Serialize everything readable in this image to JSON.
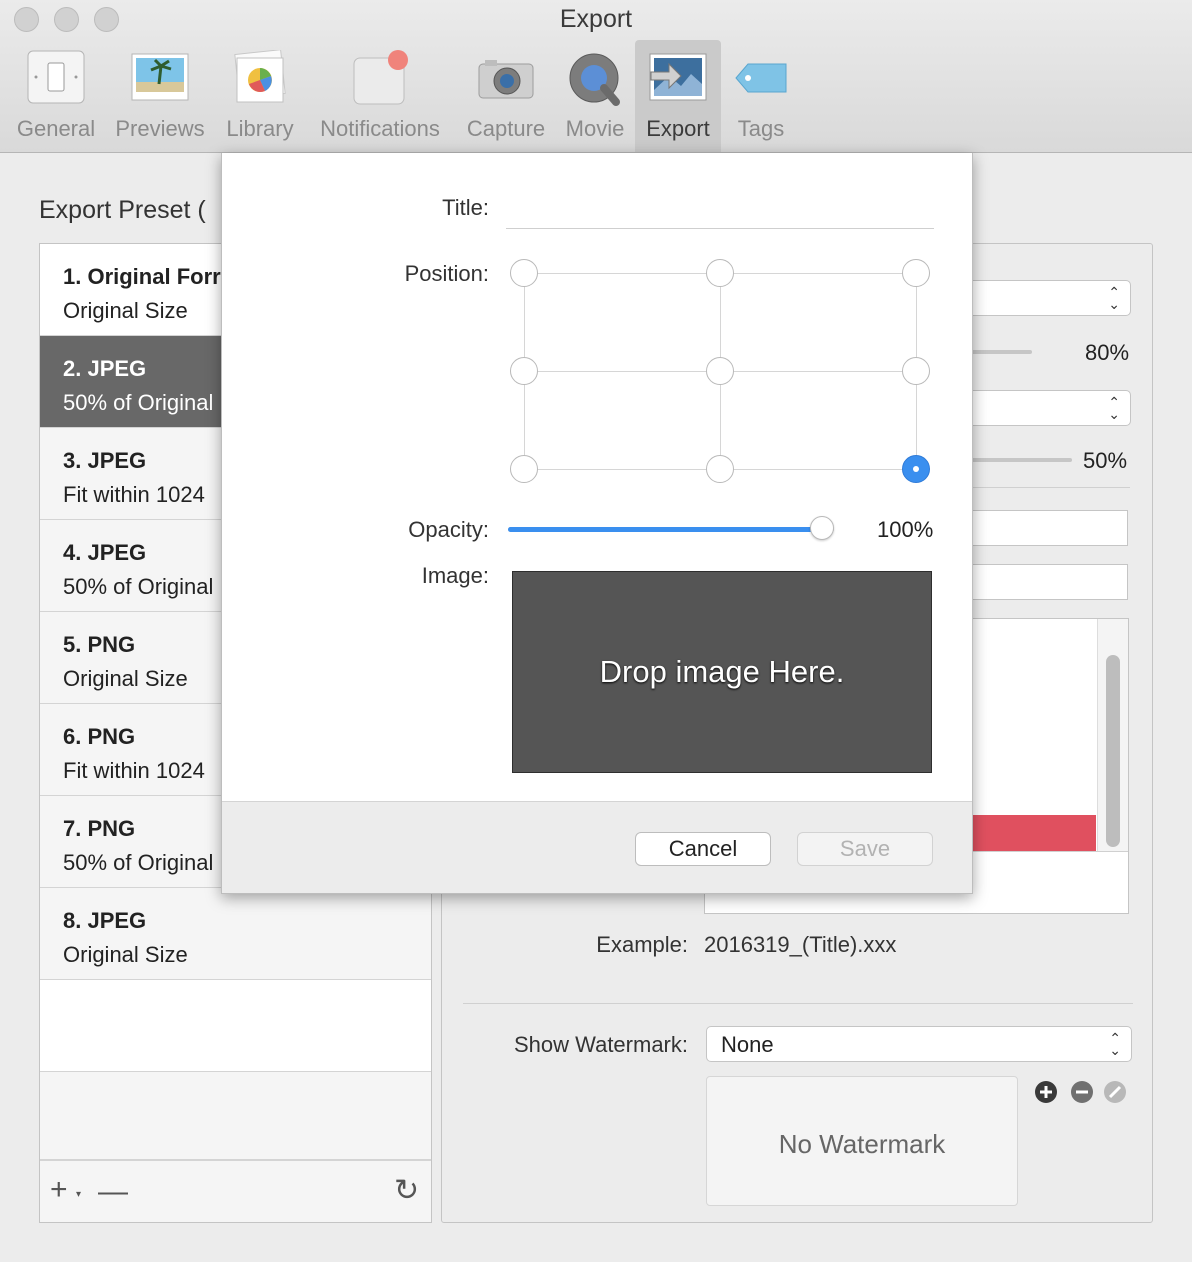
{
  "window": {
    "title": "Export"
  },
  "toolbar": [
    {
      "label": "General",
      "icon": "general-icon"
    },
    {
      "label": "Previews",
      "icon": "previews-icon"
    },
    {
      "label": "Library",
      "icon": "library-icon"
    },
    {
      "label": "Notifications",
      "icon": "notifications-icon"
    },
    {
      "label": "Capture",
      "icon": "capture-icon"
    },
    {
      "label": "Movie",
      "icon": "movie-icon"
    },
    {
      "label": "Export",
      "icon": "export-icon",
      "active": true
    },
    {
      "label": "Tags",
      "icon": "tags-icon"
    }
  ],
  "preset_heading": "Export Preset (",
  "presets": [
    {
      "title": "1. Original Forr",
      "subtitle": "Original Size"
    },
    {
      "title": "2. JPEG",
      "subtitle": "50% of Original",
      "selected": true
    },
    {
      "title": "3. JPEG",
      "subtitle": "Fit within 1024"
    },
    {
      "title": "4. JPEG",
      "subtitle": "50% of Original"
    },
    {
      "title": "5. PNG",
      "subtitle": "Original Size"
    },
    {
      "title": "6. PNG",
      "subtitle": "Fit within 1024"
    },
    {
      "title": "7. PNG",
      "subtitle": "50% of Original"
    },
    {
      "title": "8. JPEG",
      "subtitle": "Original Size"
    }
  ],
  "list_footer": {
    "add": "+",
    "remove": "—",
    "reset": "↻"
  },
  "settings": {
    "quality_pct": "80%",
    "scale_pct": "50%",
    "example_label": "Example:",
    "example_value": "2016319_(Title).xxx",
    "watermark_label": "Show Watermark:",
    "watermark_value": "None",
    "no_watermark": "No Watermark",
    "accent_red": "#e0505f"
  },
  "sheet": {
    "title_label": "Title:",
    "title_value": "",
    "position_label": "Position:",
    "position_selected": "bottom-right",
    "opacity_label": "Opacity:",
    "opacity_value": 1.0,
    "opacity_text": "100%",
    "image_label": "Image:",
    "drop_text": "Drop image Here.",
    "cancel_label": "Cancel",
    "save_label": "Save",
    "accent_blue": "#3a8fef"
  }
}
